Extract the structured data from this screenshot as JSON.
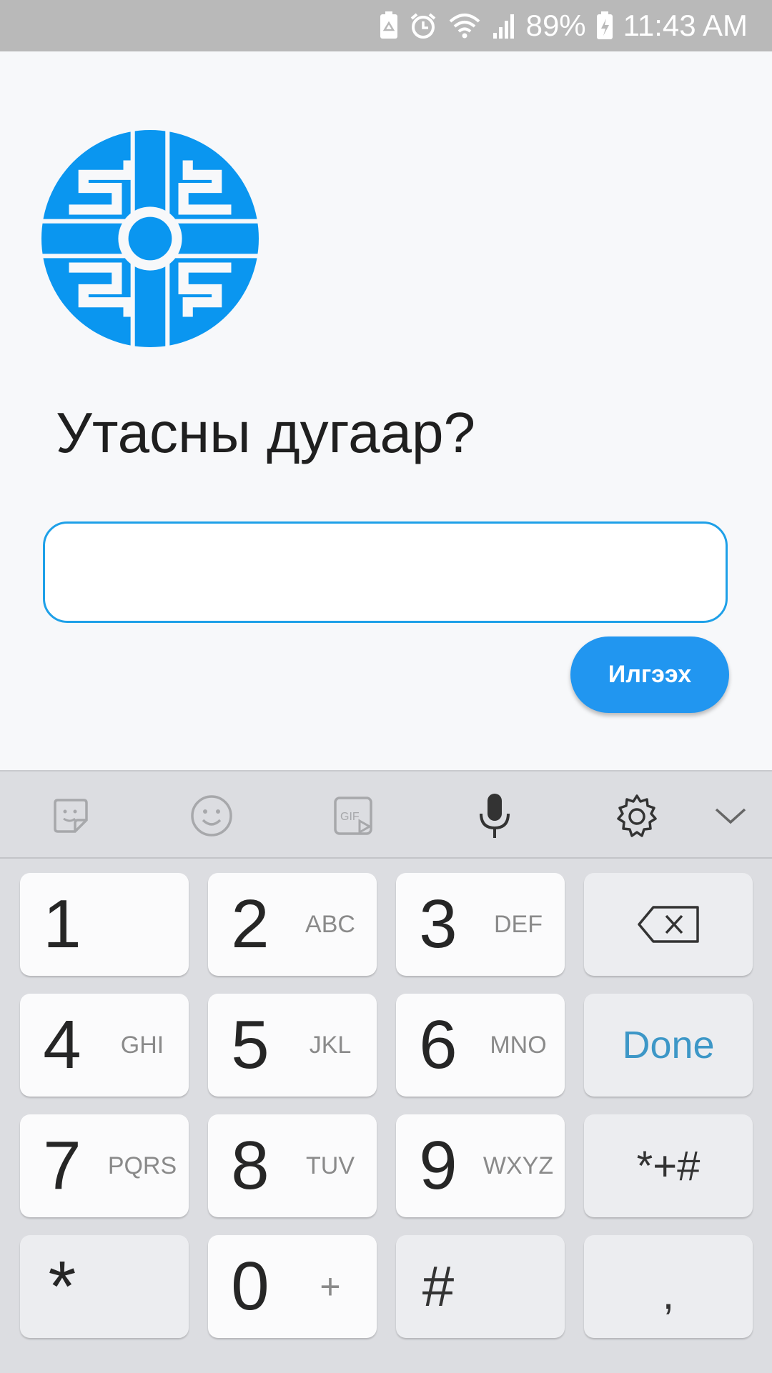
{
  "status_bar": {
    "battery_percent": "89%",
    "time": "11:43 AM",
    "icons": [
      "recycle-icon",
      "alarm-icon",
      "wifi-icon",
      "signal-icon",
      "battery-charging-icon"
    ]
  },
  "app": {
    "logo_icon": "brand-logo-icon",
    "accent_color": "#0a96f0",
    "prompt": "Утасны дугаар?",
    "phone_input": {
      "value": "",
      "placeholder": ""
    },
    "send_label": "Илгээх"
  },
  "keyboard": {
    "toolbar_icons": [
      "sticker-icon",
      "emoji-icon",
      "gif-icon",
      "microphone-icon",
      "gear-icon",
      "chevron-down-icon"
    ],
    "gif_label": "GIF",
    "keys": [
      {
        "digit": "1",
        "letters": ""
      },
      {
        "digit": "2",
        "letters": "ABC"
      },
      {
        "digit": "3",
        "letters": "DEF"
      },
      {
        "digit": "4",
        "letters": "GHI"
      },
      {
        "digit": "5",
        "letters": "JKL"
      },
      {
        "digit": "6",
        "letters": "MNO"
      },
      {
        "digit": "7",
        "letters": "PQRS"
      },
      {
        "digit": "8",
        "letters": "TUV"
      },
      {
        "digit": "9",
        "letters": "WXYZ"
      },
      {
        "digit": "0",
        "letters": "+"
      }
    ],
    "star_key": "*",
    "hash_key": "#",
    "done_label": "Done",
    "symbols_label": "*+#",
    "comma_key": ","
  }
}
